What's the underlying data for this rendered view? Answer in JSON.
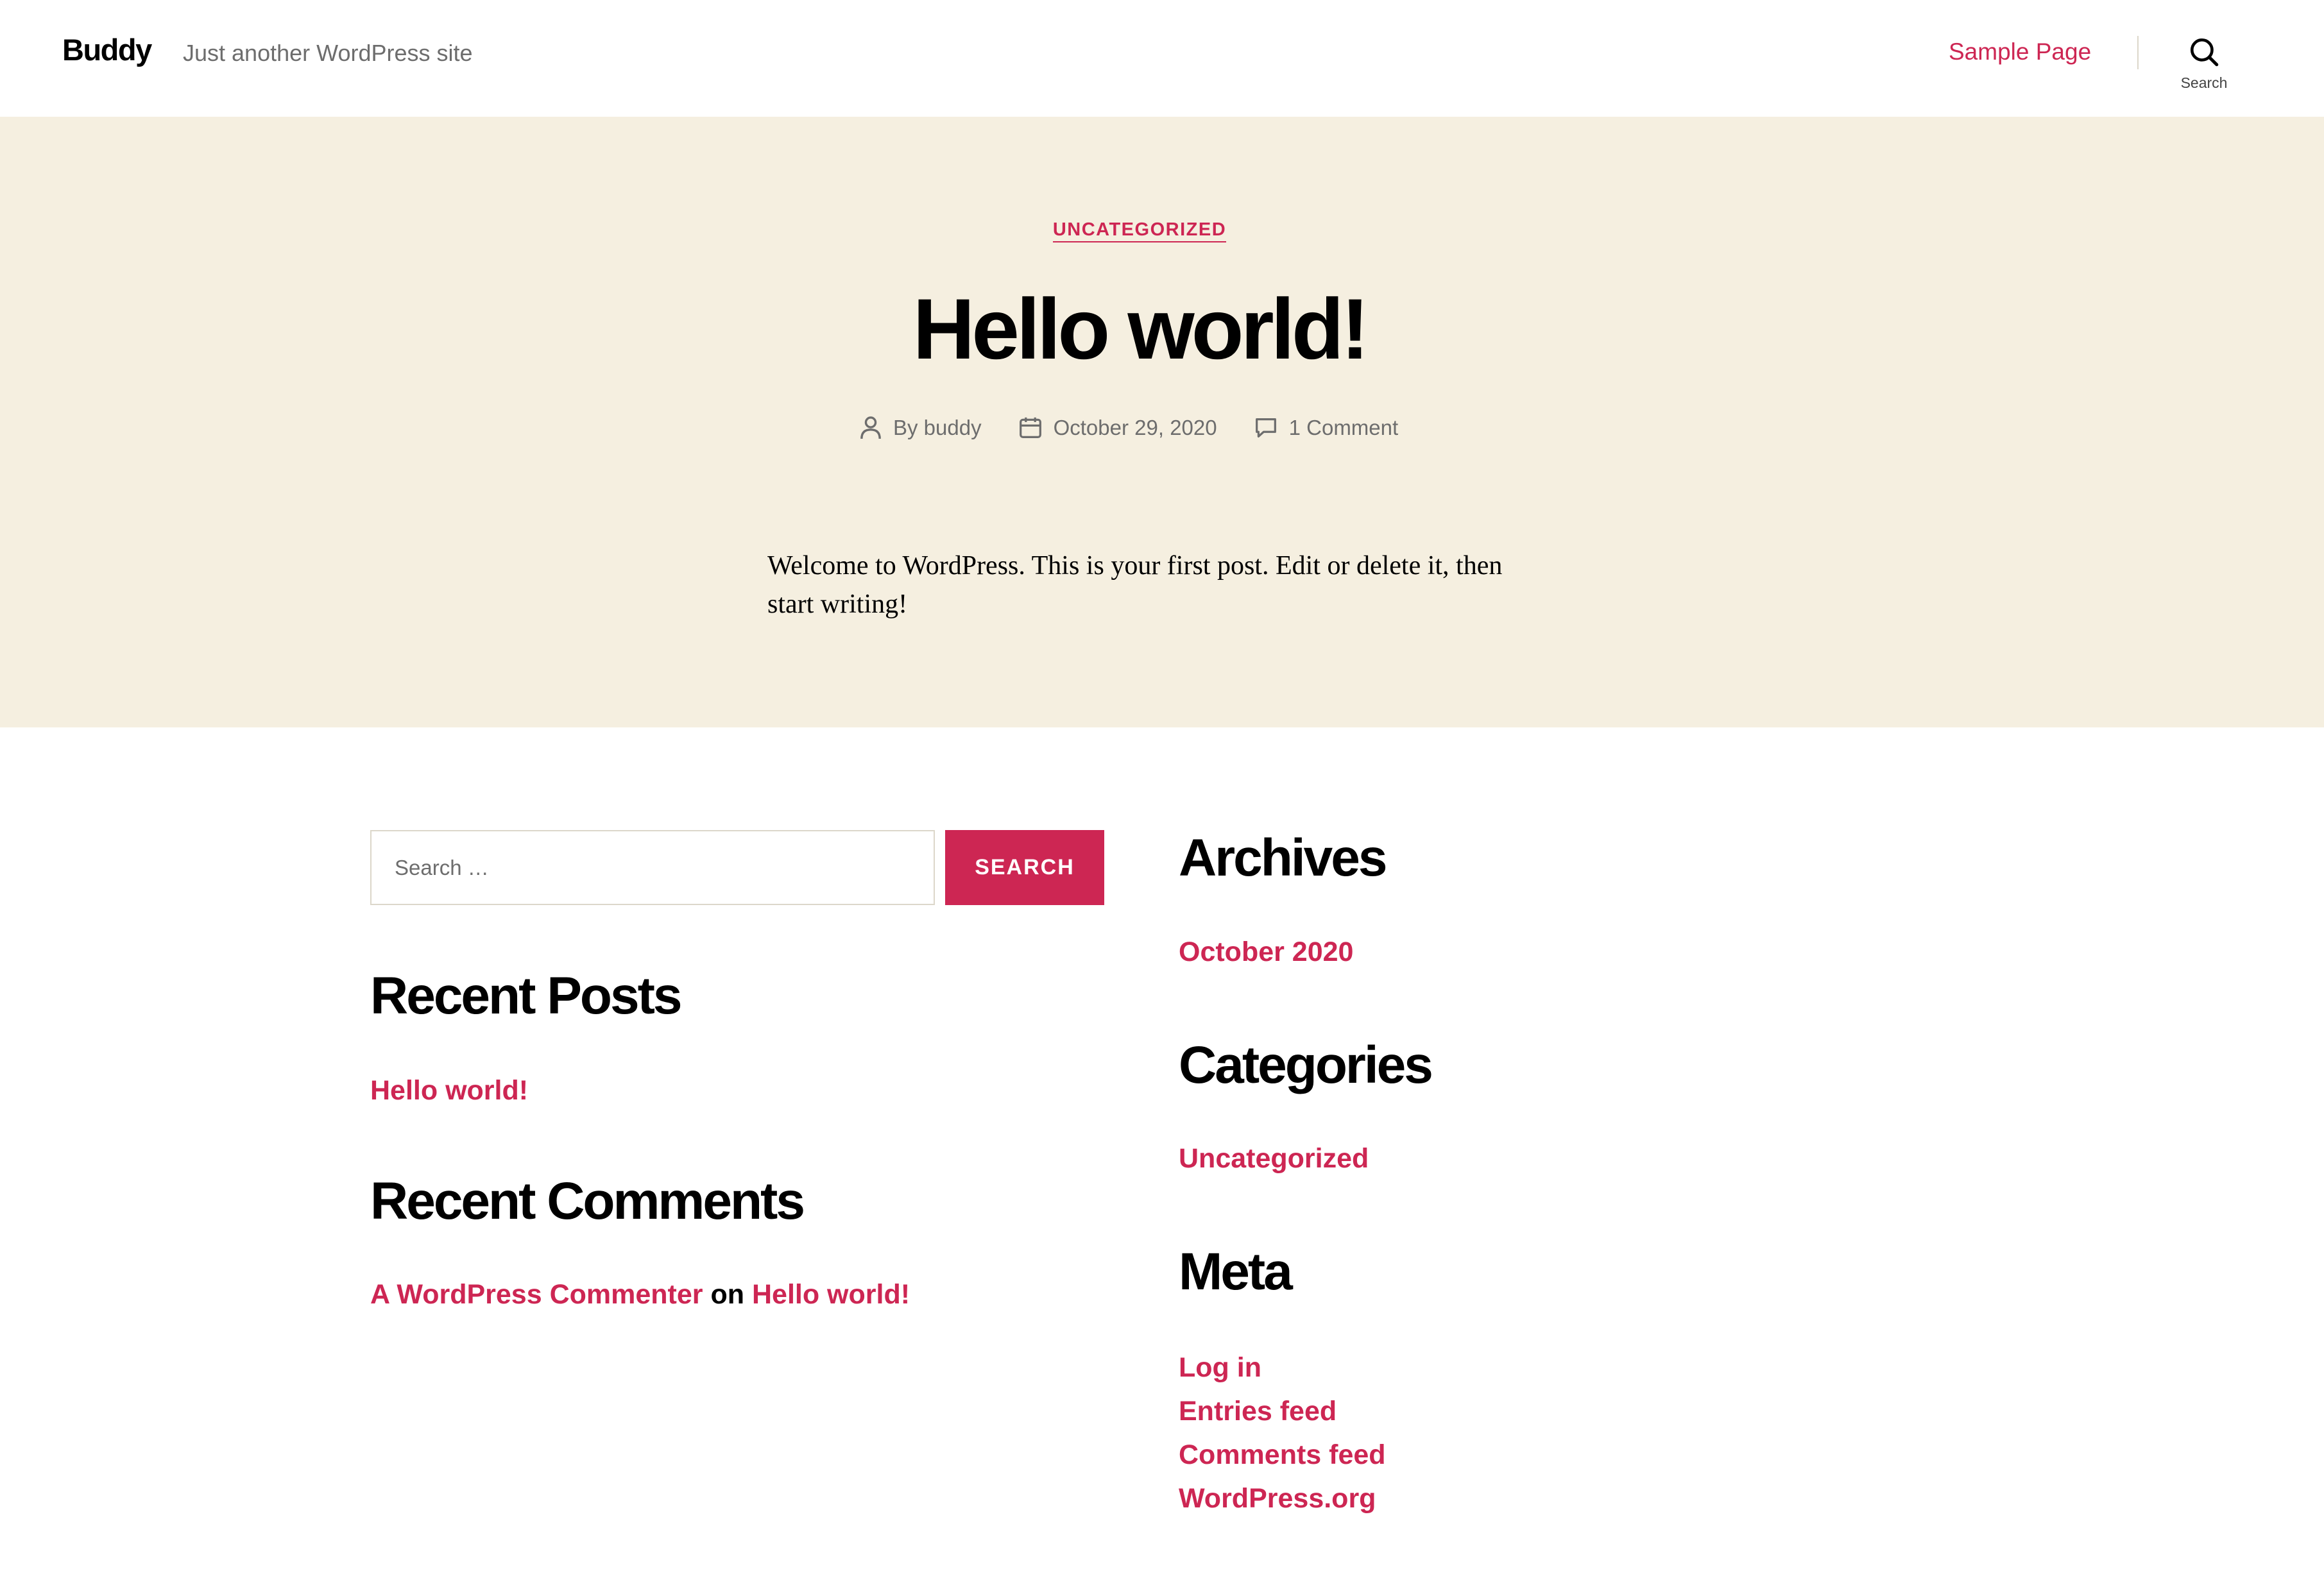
{
  "header": {
    "site_title": "Buddy",
    "site_description": "Just another WordPress site",
    "nav": [
      {
        "label": "Sample Page"
      }
    ],
    "search_label": "Search"
  },
  "post": {
    "category": "UNCATEGORIZED",
    "title": "Hello world!",
    "author": "By buddy",
    "date": "October 29, 2020",
    "comments": "1 Comment",
    "content": "Welcome to WordPress. This is your first post. Edit or delete it, then start writing!"
  },
  "widgets": {
    "search": {
      "placeholder": "Search …",
      "button_label": "SEARCH"
    },
    "recent_posts": {
      "title": "Recent Posts",
      "items": [
        "Hello world!"
      ]
    },
    "recent_comments": {
      "title": "Recent Comments",
      "author": "A WordPress Commenter",
      "connector": "on",
      "post": "Hello world!"
    },
    "archives": {
      "title": "Archives",
      "items": [
        "October 2020"
      ]
    },
    "categories": {
      "title": "Categories",
      "items": [
        "Uncategorized"
      ]
    },
    "meta": {
      "title": "Meta",
      "items": [
        "Log in",
        "Entries feed",
        "Comments feed",
        "WordPress.org"
      ]
    }
  },
  "colors": {
    "accent": "#cd2653",
    "hero_background": "#f5efe0",
    "muted_text": "#6d6d6d",
    "border": "#dcd7ca"
  }
}
